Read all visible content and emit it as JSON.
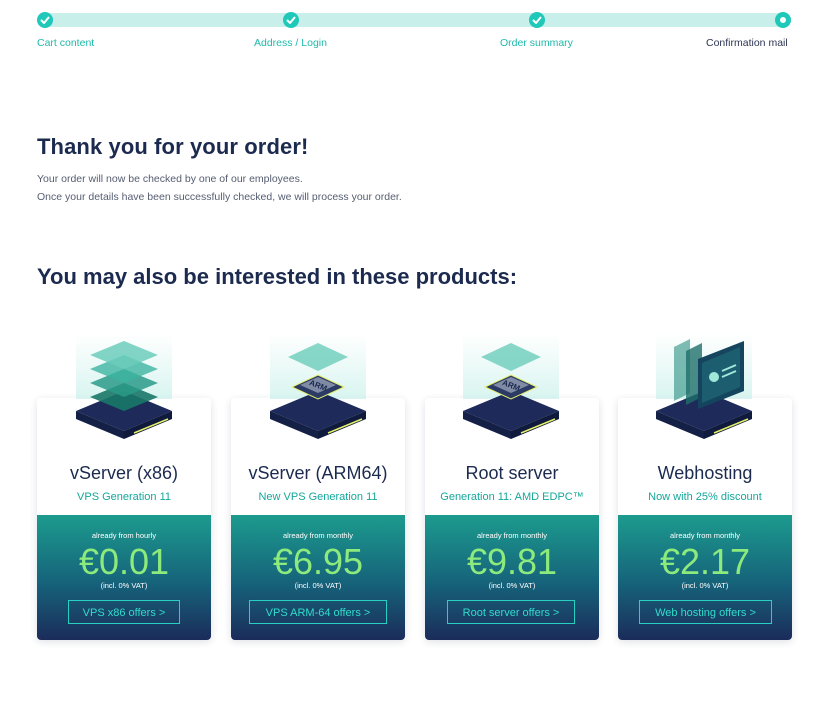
{
  "progress": {
    "steps": [
      {
        "label": "Cart content",
        "state": "done"
      },
      {
        "label": "Address / Login",
        "state": "done"
      },
      {
        "label": "Order summary",
        "state": "done"
      },
      {
        "label": "Confirmation mail",
        "state": "current"
      }
    ]
  },
  "main": {
    "heading": "Thank you for your order!",
    "message_line1": "Your order will now be checked by one of our employees.",
    "message_line2": "Once your details have been successfully checked, we will process your order.",
    "products_heading": "You may also be interested in these products:"
  },
  "products": [
    {
      "title": "vServer (x86)",
      "subtitle": "VPS Generation 11",
      "note": "already from hourly",
      "price": "€0.01",
      "vat": "(incl. 0% VAT)",
      "button": "VPS x86 offers >",
      "icon": "stacked-layers-icon"
    },
    {
      "title": "vServer (ARM64)",
      "subtitle": "New VPS Generation 11",
      "note": "already from monthly",
      "price": "€6.95",
      "vat": "(incl. 0% VAT)",
      "button": "VPS ARM-64 offers >",
      "icon": "arm-chip-icon"
    },
    {
      "title": "Root server",
      "subtitle": "Generation 11: AMD EDPC™",
      "note": "already from monthly",
      "price": "€9.81",
      "vat": "(incl. 0% VAT)",
      "button": "Root server offers >",
      "icon": "arm-chip-icon"
    },
    {
      "title": "Webhosting",
      "subtitle": "Now with 25% discount",
      "note": "already from monthly",
      "price": "€2.17",
      "vat": "(incl. 0% VAT)",
      "button": "Web hosting offers >",
      "icon": "web-panels-icon"
    }
  ],
  "chip_label": "ARM",
  "colors": {
    "accent": "#1fc8b8",
    "navy": "#1b2a4e",
    "price_green": "#8dea7c",
    "subtitle_teal": "#14a89b"
  }
}
